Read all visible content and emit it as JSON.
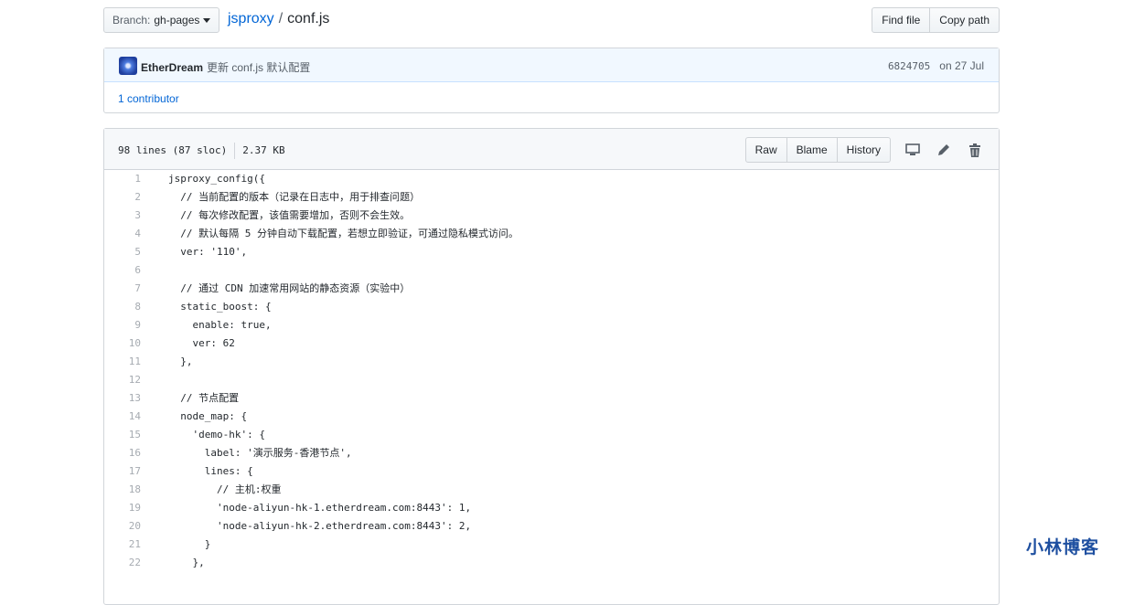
{
  "toolbar": {
    "branch_prefix": "Branch:",
    "branch_name": "gh-pages",
    "repo": "jsproxy",
    "separator": "/",
    "file": "conf.js",
    "find_file": "Find file",
    "copy_path": "Copy path"
  },
  "commit": {
    "author": "EtherDream",
    "message": "更新 conf.js 默认配置",
    "sha": "6824705",
    "date": "on 27 Jul",
    "contributors": "1 contributor"
  },
  "file": {
    "lines_info": "98 lines (87 sloc)",
    "size": "2.37 KB",
    "raw": "Raw",
    "blame": "Blame",
    "history": "History"
  },
  "code": {
    "lines": [
      {
        "n": "1",
        "text": "jsproxy_config({"
      },
      {
        "n": "2",
        "text": "  // 当前配置的版本（记录在日志中，用于排查问题）"
      },
      {
        "n": "3",
        "text": "  // 每次修改配置，该值需要增加，否则不会生效。"
      },
      {
        "n": "4",
        "text": "  // 默认每隔 5 分钟自动下载配置，若想立即验证，可通过隐私模式访问。"
      },
      {
        "n": "5",
        "text": "  ver: '110',"
      },
      {
        "n": "6",
        "text": ""
      },
      {
        "n": "7",
        "text": "  // 通过 CDN 加速常用网站的静态资源（实验中）"
      },
      {
        "n": "8",
        "text": "  static_boost: {"
      },
      {
        "n": "9",
        "text": "    enable: true,"
      },
      {
        "n": "10",
        "text": "    ver: 62"
      },
      {
        "n": "11",
        "text": "  },"
      },
      {
        "n": "12",
        "text": ""
      },
      {
        "n": "13",
        "text": "  // 节点配置"
      },
      {
        "n": "14",
        "text": "  node_map: {"
      },
      {
        "n": "15",
        "text": "    'demo-hk': {"
      },
      {
        "n": "16",
        "text": "      label: '演示服务-香港节点',"
      },
      {
        "n": "17",
        "text": "      lines: {"
      },
      {
        "n": "18",
        "text": "        // 主机:权重"
      },
      {
        "n": "19",
        "text": "        'node-aliyun-hk-1.etherdream.com:8443': 1,"
      },
      {
        "n": "20",
        "text": "        'node-aliyun-hk-2.etherdream.com:8443': 2,"
      },
      {
        "n": "21",
        "text": "      }"
      },
      {
        "n": "22",
        "text": "    },"
      }
    ]
  },
  "watermark": "小林博客"
}
